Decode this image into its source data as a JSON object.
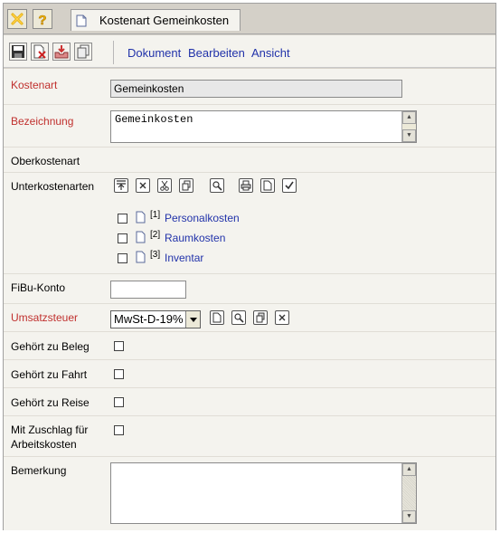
{
  "window": {
    "tab_title": "Kostenart Gemeinkosten"
  },
  "titlebar": {
    "close_icon": "close-x-icon",
    "help_icon": "help-question-icon"
  },
  "toolbar": {
    "tools": [
      "save-icon",
      "delete-icon",
      "inbox-icon",
      "copy-icon"
    ],
    "menu": [
      "Dokument",
      "Bearbeiten",
      "Ansicht"
    ]
  },
  "form": {
    "kostenart": {
      "label": "Kostenart",
      "value": "Gemeinkosten"
    },
    "bezeichnung": {
      "label": "Bezeichnung",
      "value": "Gemeinkosten"
    },
    "oberkostenart": {
      "label": "Oberkostenart"
    },
    "unterkostenarten": {
      "label": "Unterkostenarten",
      "tools": [
        "move-top-icon",
        "remove-icon",
        "cut-icon",
        "copy-icon",
        "search-icon",
        "print-icon",
        "new-document-icon",
        "check-icon"
      ],
      "items": [
        {
          "index": "[1]",
          "name": "Personalkosten"
        },
        {
          "index": "[2]",
          "name": "Raumkosten"
        },
        {
          "index": "[3]",
          "name": "Inventar"
        }
      ]
    },
    "fibu": {
      "label": "FiBu-Konto",
      "value": ""
    },
    "umsatzsteuer": {
      "label": "Umsatzsteuer",
      "selected": "MwSt-D-19%",
      "tools": [
        "new-document-icon",
        "search-icon",
        "copy-icon",
        "remove-icon"
      ]
    },
    "beleg": {
      "label": "Gehört zu Beleg"
    },
    "fahrt": {
      "label": "Gehört zu Fahrt"
    },
    "reise": {
      "label": "Gehört zu Reise"
    },
    "zuschlag": {
      "label_line1": "Mit Zuschlag für",
      "label_line2": "Arbeitskosten"
    },
    "bemerkung": {
      "label": "Bemerkung",
      "value": ""
    }
  },
  "colors": {
    "required_label": "#c0302e",
    "link": "#2233aa",
    "panel": "#f4f3ee"
  }
}
